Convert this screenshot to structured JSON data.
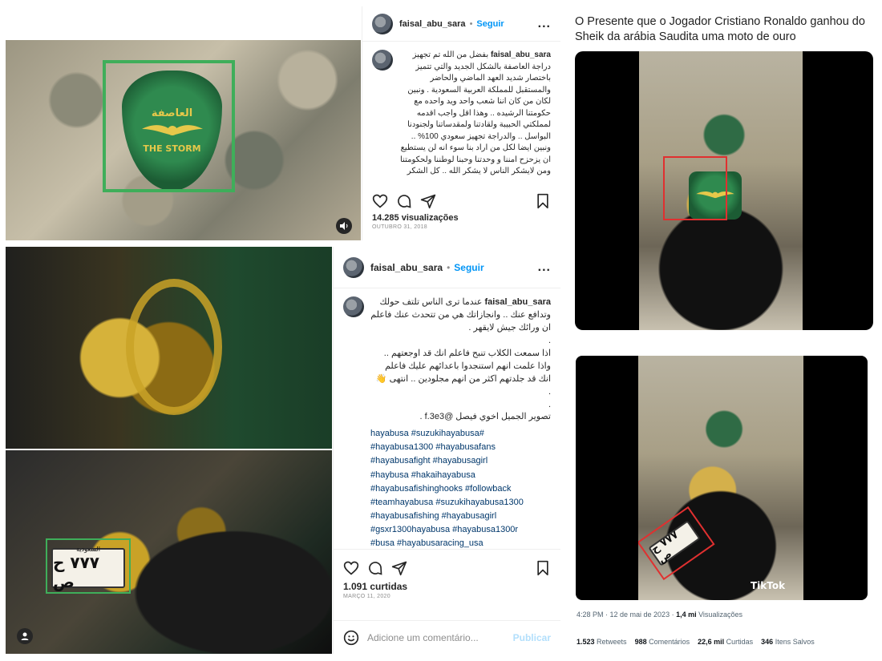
{
  "post1": {
    "username": "faisal_abu_sara",
    "separator": "•",
    "follow_label": "Seguir",
    "more_label": "...",
    "caption_username": "faisal_abu_sara",
    "caption_text": "بفضل من الله تم تجهيز دراجة العاصفة بالشكل الجديد والتي تتميز باختصار شديد العهد الماضي والحاضر والمستقبل للمملكة العربية السعودية . ونبين لكان من كان اننا شعب واحد ويد واحده مع حكومتنا الرشيده .. وهذا اقل واجب اقدمه لمملكتي الحبيبة ولقادتنا ولمقدساتنا ولجنودنا البواسل .. والدراجة تجهيز سعودي 100% .. ونبين ايضا لكل من اراد بنا سوء انه لن يستطيع ان يزحزح امننا و وحدتنا وحبنا لوطننا ولحكومتنا ومن لايشكر الناس لا يشكر الله .. كل الشكر",
    "views": "14.285 visualizações",
    "date": "OUTUBRO 31, 2018",
    "emblem_text": "THE STORM",
    "emblem_arabic": "العاصفة"
  },
  "post2": {
    "username": "faisal_abu_sara",
    "separator": "•",
    "follow_label": "Seguir",
    "more_label": "...",
    "caption_username": "faisal_abu_sara",
    "caption_lines": [
      "عندما ترى الناس تلتف حولك وتدافع عنك .. وانجازاتك هي من تتحدث عنك فاعلم ان ورائك جيش لايقهر .",
      ".",
      "اذا سمعت الكلاب تنبح فاعلم انك قد اوجعتهم .. واذا علمت انهم استنجدوا باعدائهم عليك فاعلم انك قد جلدتهم اكثر من انهم مجلودين .. انتهى 👋",
      ".",
      ".",
      "تصوير الجميل اخوي فيصل @f.3e3 ."
    ],
    "hashtags": [
      "hayabusa #suzukihayabusa#",
      "#hayabusa1300 #hayabusafans",
      "#hayabusafight #hayabusagirl",
      "#haybusa #hakaihayabusa",
      "#hayabusafishinghooks #followback",
      "#teamhayabusa #suzukihayabusa1300",
      "#hayabusafishing #hayabusagirl",
      "#gsxr1300hayabusa #hayabusa1300r",
      "#busa #hayabusaracing_usa"
    ],
    "likes": "1.091 curtidas",
    "date": "MARÇO 11, 2020",
    "comment_placeholder": "Adicione um comentário...",
    "publish_label": "Publicar",
    "plate_top": "السعودية",
    "plate_number": "٧٧٧ ح ص"
  },
  "tweet": {
    "text": "O Presente que o Jogador Cristiano Ronaldo ganhou do Sheik da arábia Saudita  uma moto de ouro",
    "time": "4:28 PM · 12 de mai de 2023 · ",
    "views_value": "1,4 mi",
    "views_label": " Visualizações",
    "retweets_value": "1.523",
    "retweets_label": " Retweets",
    "comments_value": "988",
    "comments_label": " Comentários",
    "likes_value": "22,6 mil",
    "likes_label": " Curtidas",
    "saved_value": "346",
    "saved_label": " Itens Salvos",
    "tiktok_label": "TikTok",
    "plate_number": "٧٧٧ ح ص"
  },
  "colors": {
    "instagram_blue": "#0095f6",
    "highlight_green": "#3fae5a",
    "highlight_red": "#e03030"
  },
  "icons": [
    "heart-icon",
    "comment-icon",
    "share-icon",
    "bookmark-icon",
    "sound-icon",
    "user-tag-icon",
    "emoji-icon"
  ]
}
